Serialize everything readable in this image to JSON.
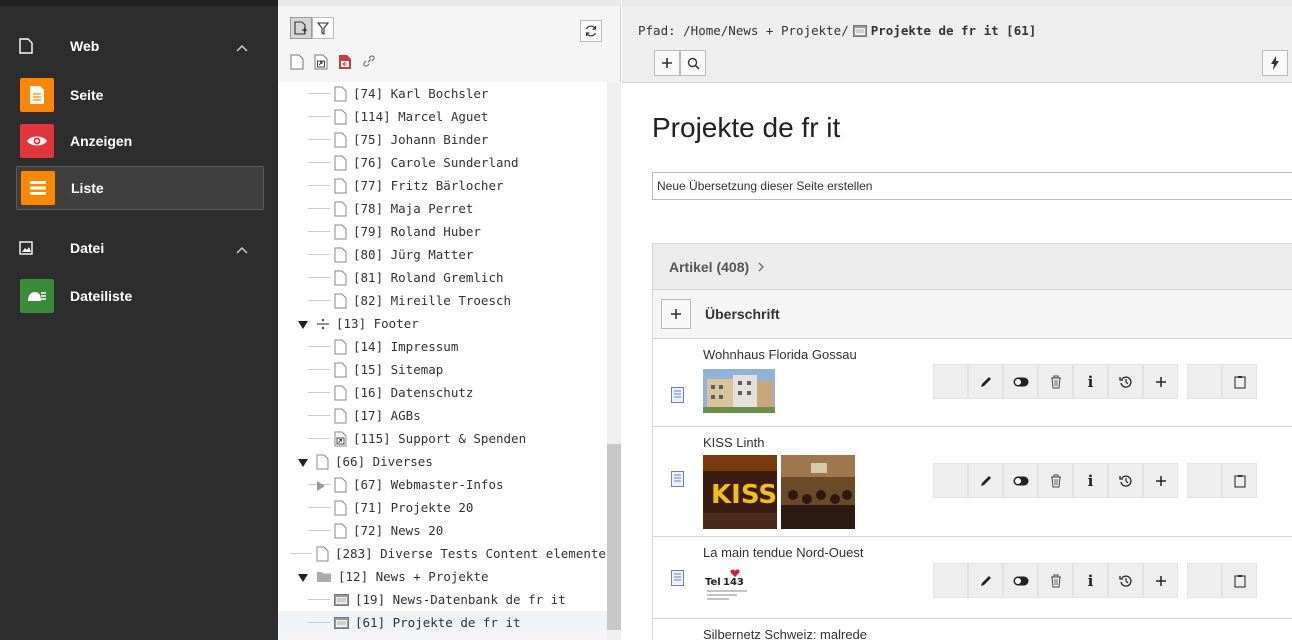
{
  "module_menu": {
    "groups": [
      {
        "label": "Web",
        "icon": "page-outline-icon",
        "expanded": true,
        "items": [
          {
            "label": "Seite",
            "icon": "page-icon",
            "color": "#ff8700"
          },
          {
            "label": "Anzeigen",
            "icon": "eye-icon",
            "color": "#e0363c"
          },
          {
            "label": "Liste",
            "icon": "list-icon",
            "color": "#ff8700",
            "active": true
          }
        ]
      },
      {
        "label": "Datei",
        "icon": "image-icon",
        "expanded": true,
        "items": [
          {
            "label": "Dateiliste",
            "icon": "file-list-icon",
            "color": "#3a8c3b"
          }
        ]
      }
    ]
  },
  "page_tree": {
    "rows": [
      {
        "label": "[74] Karl Bochsler"
      },
      {
        "label": "[114] Marcel Aguet"
      },
      {
        "label": "[75] Johann Binder"
      },
      {
        "label": "[76] Carole Sunderland"
      },
      {
        "label": "[77] Fritz Bärlocher"
      },
      {
        "label": "[78] Maja Perret"
      },
      {
        "label": "[79] Roland Huber"
      },
      {
        "label": "[80] Jürg Matter"
      },
      {
        "label": "[81] Roland Gremlich"
      },
      {
        "label": "[82] Mireille Troesch"
      },
      {
        "label": "[13] Footer"
      },
      {
        "label": "[14] Impressum"
      },
      {
        "label": "[15] Sitemap"
      },
      {
        "label": "[16] Datenschutz"
      },
      {
        "label": "[17] AGBs"
      },
      {
        "label": "[115] Support & Spenden"
      },
      {
        "label": "[66] Diverses"
      },
      {
        "label": "[67] Webmaster-Infos"
      },
      {
        "label": "[71] Projekte 20"
      },
      {
        "label": "[72] News 20"
      },
      {
        "label": "[283] Diverse Tests Content elemente"
      },
      {
        "label": "[12] News + Projekte"
      },
      {
        "label": "[19] News-Datenbank de fr it"
      },
      {
        "label": "[61] Projekte de fr it"
      }
    ]
  },
  "docheader": {
    "path_prefix": "Pfad: /Home/News + Projekte/",
    "path_current": "Projekte de fr it [61]"
  },
  "content": {
    "title": "Projekte de fr it",
    "translation_select": "Neue Übersetzung dieser Seite erstellen",
    "table_title": "Artikel (408)",
    "column_header": "Überschrift",
    "records": [
      {
        "title": "Wohnhaus Florida Gossau"
      },
      {
        "title": "KISS Linth"
      },
      {
        "title": "La main tendue Nord-Ouest"
      },
      {
        "title": "Silbernetz Schweiz: malrede"
      }
    ]
  }
}
